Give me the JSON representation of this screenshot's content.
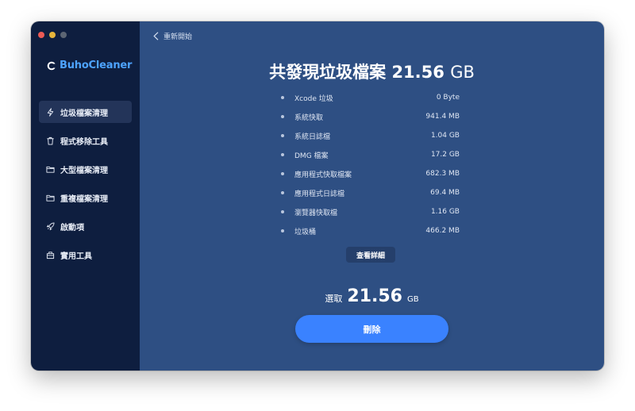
{
  "window": {
    "brand": "BuhoCleaner"
  },
  "sidebar": {
    "items": [
      {
        "label": "垃圾檔案清理",
        "icon": "lightning-icon",
        "active": true
      },
      {
        "label": "程式移除工具",
        "icon": "trash-icon",
        "active": false
      },
      {
        "label": "大型檔案清理",
        "icon": "folder-icon",
        "active": false
      },
      {
        "label": "重複檔案清理",
        "icon": "duplicate-folder-icon",
        "active": false
      },
      {
        "label": "啟動項",
        "icon": "rocket-icon",
        "active": false
      },
      {
        "label": "實用工具",
        "icon": "toolbox-icon",
        "active": false
      }
    ]
  },
  "main": {
    "back_label": "重新開始",
    "headline_prefix": "共發現垃圾檔案",
    "headline_number": "21.56",
    "headline_unit": "GB",
    "items": [
      {
        "label": "Xcode 垃圾",
        "value": "0 Byte"
      },
      {
        "label": "系統快取",
        "value": "941.4 MB"
      },
      {
        "label": "系統日誌檔",
        "value": "1.04 GB"
      },
      {
        "label": "DMG 檔案",
        "value": "17.2 GB"
      },
      {
        "label": "應用程式快取檔案",
        "value": "682.3 MB"
      },
      {
        "label": "應用程式日誌檔",
        "value": "69.4 MB"
      },
      {
        "label": "瀏覽器快取檔",
        "value": "1.16 GB"
      },
      {
        "label": "垃圾桶",
        "value": "466.2 MB"
      }
    ],
    "details_label": "查看詳細",
    "selected_label": "選取",
    "selected_number": "21.56",
    "selected_unit": "GB",
    "delete_label": "刪除"
  },
  "colors": {
    "sidebar_bg": "#0e1e3f",
    "main_bg": "#2e4f83",
    "accent": "#3a82ff",
    "brand": "#4da3ff"
  }
}
